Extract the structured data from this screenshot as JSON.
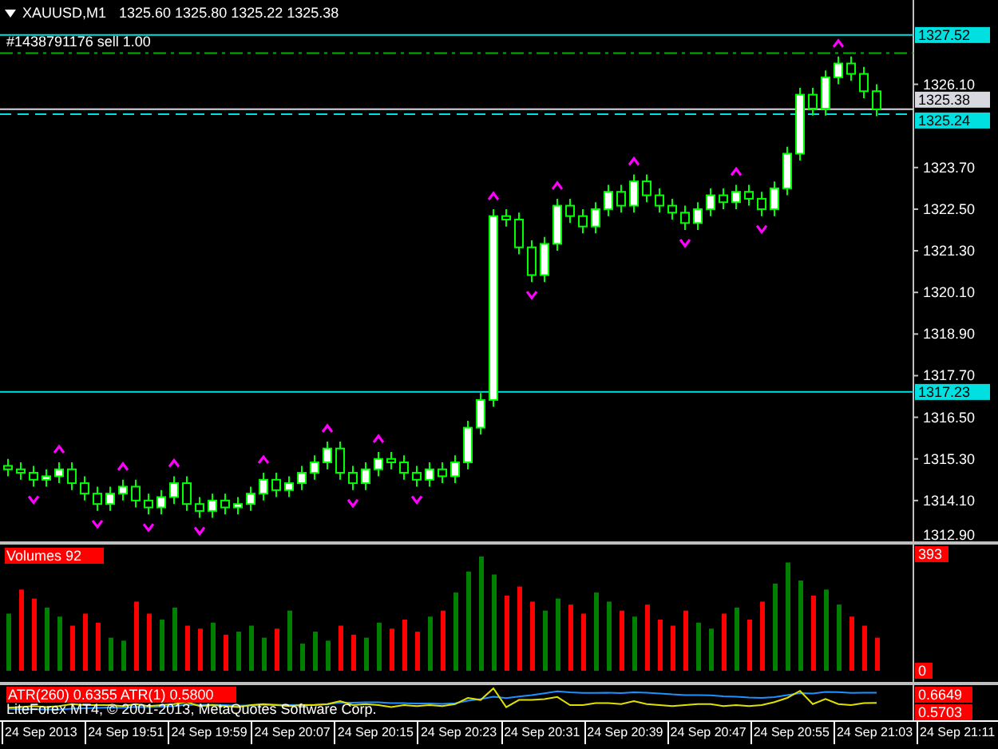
{
  "header": {
    "symbol": "XAUUSD,M1",
    "quotes": "1325.60 1325.80 1325.22 1325.38"
  },
  "price_panel": {
    "order_label": "#1438791176 sell 1.00",
    "chart_data": {
      "type": "candlestick",
      "ylim": [
        1312.83,
        1328.53
      ],
      "yticks": [
        {
          "value": 1326.1,
          "label": "1326.10"
        },
        {
          "value": 1323.7,
          "label": "1323.70"
        },
        {
          "value": 1322.5,
          "label": "1322.50"
        },
        {
          "value": 1321.3,
          "label": "1321.30"
        },
        {
          "value": 1320.1,
          "label": "1320.10"
        },
        {
          "value": 1318.9,
          "label": "1318.90"
        },
        {
          "value": 1317.7,
          "label": "1317.70"
        },
        {
          "value": 1316.5,
          "label": "1316.50"
        },
        {
          "value": 1315.3,
          "label": "1315.30"
        },
        {
          "value": 1314.1,
          "label": "1314.10"
        },
        {
          "value": 1312.9,
          "label": "1312.90"
        }
      ],
      "categories": [
        null,
        null,
        null,
        null,
        null,
        null,
        null,
        null,
        null,
        null,
        null,
        null,
        null,
        null,
        null,
        null,
        null,
        null,
        null,
        null,
        null,
        null,
        null,
        null,
        null,
        null,
        null,
        null,
        null,
        null,
        null,
        null,
        null,
        null,
        null,
        null,
        null,
        null,
        null,
        null,
        null,
        null,
        null,
        null,
        null,
        null,
        null,
        null,
        null,
        null,
        null,
        null,
        null,
        null,
        null,
        null,
        null,
        null,
        null,
        null,
        null,
        null,
        null,
        null,
        null,
        null,
        null,
        null,
        null
      ],
      "ohlc": [
        [
          1315.1,
          1315.3,
          1314.8,
          1315.0
        ],
        [
          1315.0,
          1315.2,
          1314.7,
          1314.9
        ],
        [
          1314.9,
          1315.1,
          1314.5,
          1314.7
        ],
        [
          1314.7,
          1315.0,
          1314.5,
          1314.8
        ],
        [
          1314.8,
          1315.2,
          1314.6,
          1315.0
        ],
        [
          1315.0,
          1315.2,
          1314.4,
          1314.6
        ],
        [
          1314.6,
          1314.8,
          1314.1,
          1314.3
        ],
        [
          1314.3,
          1314.5,
          1313.8,
          1314.0
        ],
        [
          1314.0,
          1314.5,
          1313.8,
          1314.3
        ],
        [
          1314.3,
          1314.7,
          1314.1,
          1314.5
        ],
        [
          1314.5,
          1314.7,
          1313.9,
          1314.1
        ],
        [
          1314.1,
          1314.3,
          1313.7,
          1313.9
        ],
        [
          1313.9,
          1314.4,
          1313.7,
          1314.2
        ],
        [
          1314.2,
          1314.8,
          1314.0,
          1314.6
        ],
        [
          1314.6,
          1314.8,
          1313.8,
          1314.0
        ],
        [
          1314.0,
          1314.2,
          1313.6,
          1313.8
        ],
        [
          1313.8,
          1314.3,
          1313.6,
          1314.1
        ],
        [
          1314.1,
          1314.3,
          1313.7,
          1313.9
        ],
        [
          1313.9,
          1314.2,
          1313.7,
          1314.0
        ],
        [
          1314.0,
          1314.5,
          1313.8,
          1314.3
        ],
        [
          1314.3,
          1314.9,
          1314.1,
          1314.7
        ],
        [
          1314.7,
          1314.9,
          1314.2,
          1314.4
        ],
        [
          1314.4,
          1314.8,
          1314.2,
          1314.6
        ],
        [
          1314.6,
          1315.1,
          1314.4,
          1314.9
        ],
        [
          1314.9,
          1315.4,
          1314.7,
          1315.2
        ],
        [
          1315.2,
          1315.8,
          1315.0,
          1315.6
        ],
        [
          1315.6,
          1315.8,
          1314.7,
          1314.9
        ],
        [
          1314.9,
          1315.1,
          1314.4,
          1314.6
        ],
        [
          1314.6,
          1315.2,
          1314.4,
          1315.0
        ],
        [
          1315.0,
          1315.5,
          1314.8,
          1315.3
        ],
        [
          1315.3,
          1315.5,
          1315.0,
          1315.2
        ],
        [
          1315.2,
          1315.4,
          1314.7,
          1314.9
        ],
        [
          1314.9,
          1315.1,
          1314.5,
          1314.7
        ],
        [
          1314.7,
          1315.2,
          1314.5,
          1315.0
        ],
        [
          1315.0,
          1315.2,
          1314.6,
          1314.8
        ],
        [
          1314.8,
          1315.4,
          1314.6,
          1315.2
        ],
        [
          1315.2,
          1316.4,
          1315.0,
          1316.2
        ],
        [
          1316.2,
          1317.2,
          1316.0,
          1317.0
        ],
        [
          1317.0,
          1322.5,
          1316.8,
          1322.3
        ],
        [
          1322.3,
          1322.5,
          1322.0,
          1322.2
        ],
        [
          1322.2,
          1322.4,
          1321.2,
          1321.4
        ],
        [
          1321.4,
          1321.6,
          1320.4,
          1320.6
        ],
        [
          1320.6,
          1321.7,
          1320.4,
          1321.5
        ],
        [
          1321.5,
          1322.8,
          1321.3,
          1322.6
        ],
        [
          1322.6,
          1322.8,
          1322.1,
          1322.3
        ],
        [
          1322.3,
          1322.5,
          1321.8,
          1322.0
        ],
        [
          1322.0,
          1322.7,
          1321.8,
          1322.5
        ],
        [
          1322.5,
          1323.2,
          1322.3,
          1323.0
        ],
        [
          1323.0,
          1323.2,
          1322.4,
          1322.6
        ],
        [
          1322.6,
          1323.5,
          1322.4,
          1323.3
        ],
        [
          1323.3,
          1323.5,
          1322.7,
          1322.9
        ],
        [
          1322.9,
          1323.1,
          1322.4,
          1322.6
        ],
        [
          1322.6,
          1322.8,
          1322.2,
          1322.4
        ],
        [
          1322.4,
          1322.6,
          1321.9,
          1322.1
        ],
        [
          1322.1,
          1322.7,
          1321.9,
          1322.5
        ],
        [
          1322.5,
          1323.1,
          1322.3,
          1322.9
        ],
        [
          1322.9,
          1323.1,
          1322.5,
          1322.7
        ],
        [
          1322.7,
          1323.2,
          1322.5,
          1323.0
        ],
        [
          1323.0,
          1323.2,
          1322.6,
          1322.8
        ],
        [
          1322.8,
          1323.0,
          1322.3,
          1322.5
        ],
        [
          1322.5,
          1323.3,
          1322.3,
          1323.1
        ],
        [
          1323.1,
          1324.3,
          1322.9,
          1324.1
        ],
        [
          1324.1,
          1326.0,
          1323.9,
          1325.8
        ],
        [
          1325.8,
          1326.0,
          1325.2,
          1325.4
        ],
        [
          1325.4,
          1326.5,
          1325.2,
          1326.3
        ],
        [
          1326.3,
          1326.9,
          1326.1,
          1326.7
        ],
        [
          1326.7,
          1326.9,
          1326.2,
          1326.4
        ],
        [
          1326.4,
          1326.6,
          1325.7,
          1325.9
        ],
        [
          1325.9,
          1326.1,
          1325.18,
          1325.38
        ]
      ],
      "ref_lines": [
        {
          "axis": "y",
          "value": 1327.52,
          "label": "1327.52",
          "color": "#00e0e0"
        },
        {
          "axis": "y",
          "value": 1327.0,
          "color": "#00b000"
        },
        {
          "axis": "y",
          "value": 1325.38,
          "label": "1325.38",
          "color": "#d8d8e0"
        },
        {
          "axis": "y",
          "value": 1325.24,
          "label": "1325.24",
          "color": "#00e0e0"
        },
        {
          "axis": "y",
          "value": 1317.23,
          "label": "1317.23",
          "color": "#00e0e0"
        }
      ]
    }
  },
  "volume_panel": {
    "chart_data": {
      "type": "bar",
      "title": "Volumes 92",
      "categories": [
        null,
        null,
        null,
        null,
        null,
        null,
        null,
        null,
        null,
        null,
        null,
        null,
        null,
        null,
        null,
        null,
        null,
        null,
        null,
        null,
        null,
        null,
        null,
        null,
        null,
        null,
        null,
        null,
        null,
        null,
        null,
        null,
        null,
        null,
        null,
        null,
        null,
        null,
        null,
        null,
        null,
        null,
        null,
        null,
        null,
        null,
        null,
        null,
        null,
        null,
        null,
        null,
        null,
        null,
        null,
        null,
        null,
        null,
        null,
        null,
        null,
        null,
        null,
        null,
        null,
        null,
        null,
        null,
        null
      ],
      "ylim": [
        0,
        393
      ],
      "yticks": [
        {
          "value": 393,
          "label": "393"
        },
        {
          "value": 0,
          "label": "0"
        }
      ],
      "series": [
        {
          "color": "#008000",
          "values": [
            190,
            null,
            null,
            210,
            180,
            null,
            null,
            null,
            110,
            100,
            null,
            null,
            170,
            210,
            null,
            null,
            160,
            null,
            130,
            150,
            110,
            null,
            200,
            90,
            130,
            100,
            null,
            null,
            110,
            160,
            null,
            null,
            null,
            180,
            null,
            260,
            330,
            380,
            320,
            null,
            null,
            null,
            200,
            240,
            null,
            null,
            260,
            230,
            null,
            180,
            null,
            null,
            null,
            null,
            160,
            140,
            null,
            210,
            null,
            null,
            290,
            360,
            300,
            null,
            270,
            220,
            null,
            null,
            null
          ]
        },
        {
          "color": "#ff0000",
          "values": [
            null,
            270,
            240,
            null,
            null,
            150,
            190,
            160,
            null,
            null,
            230,
            190,
            null,
            null,
            150,
            140,
            null,
            120,
            null,
            null,
            null,
            140,
            null,
            null,
            null,
            null,
            150,
            120,
            null,
            null,
            140,
            170,
            130,
            null,
            200,
            null,
            null,
            null,
            null,
            250,
            280,
            230,
            null,
            null,
            220,
            190,
            null,
            null,
            200,
            null,
            220,
            170,
            150,
            200,
            null,
            null,
            190,
            null,
            170,
            230,
            null,
            null,
            null,
            250,
            null,
            null,
            180,
            150,
            110
          ]
        }
      ]
    }
  },
  "atr_panel": {
    "label": "ATR(260) 0.6355  ATR(1) 0.5800",
    "readings": [
      "0.6649",
      "0.5703"
    ],
    "footer_text": "LiteForex MT4, © 2001-2013, MetaQuotes Software Corp."
  },
  "time_axis": [
    "24 Sep 2013",
    "24 Sep 19:51",
    "24 Sep 19:59",
    "24 Sep 20:07",
    "24 Sep 20:15",
    "24 Sep 20:23",
    "24 Sep 20:31",
    "24 Sep 20:39",
    "24 Sep 20:47",
    "24 Sep 20:55",
    "24 Sep 21:03",
    "24 Sep 21:11"
  ]
}
